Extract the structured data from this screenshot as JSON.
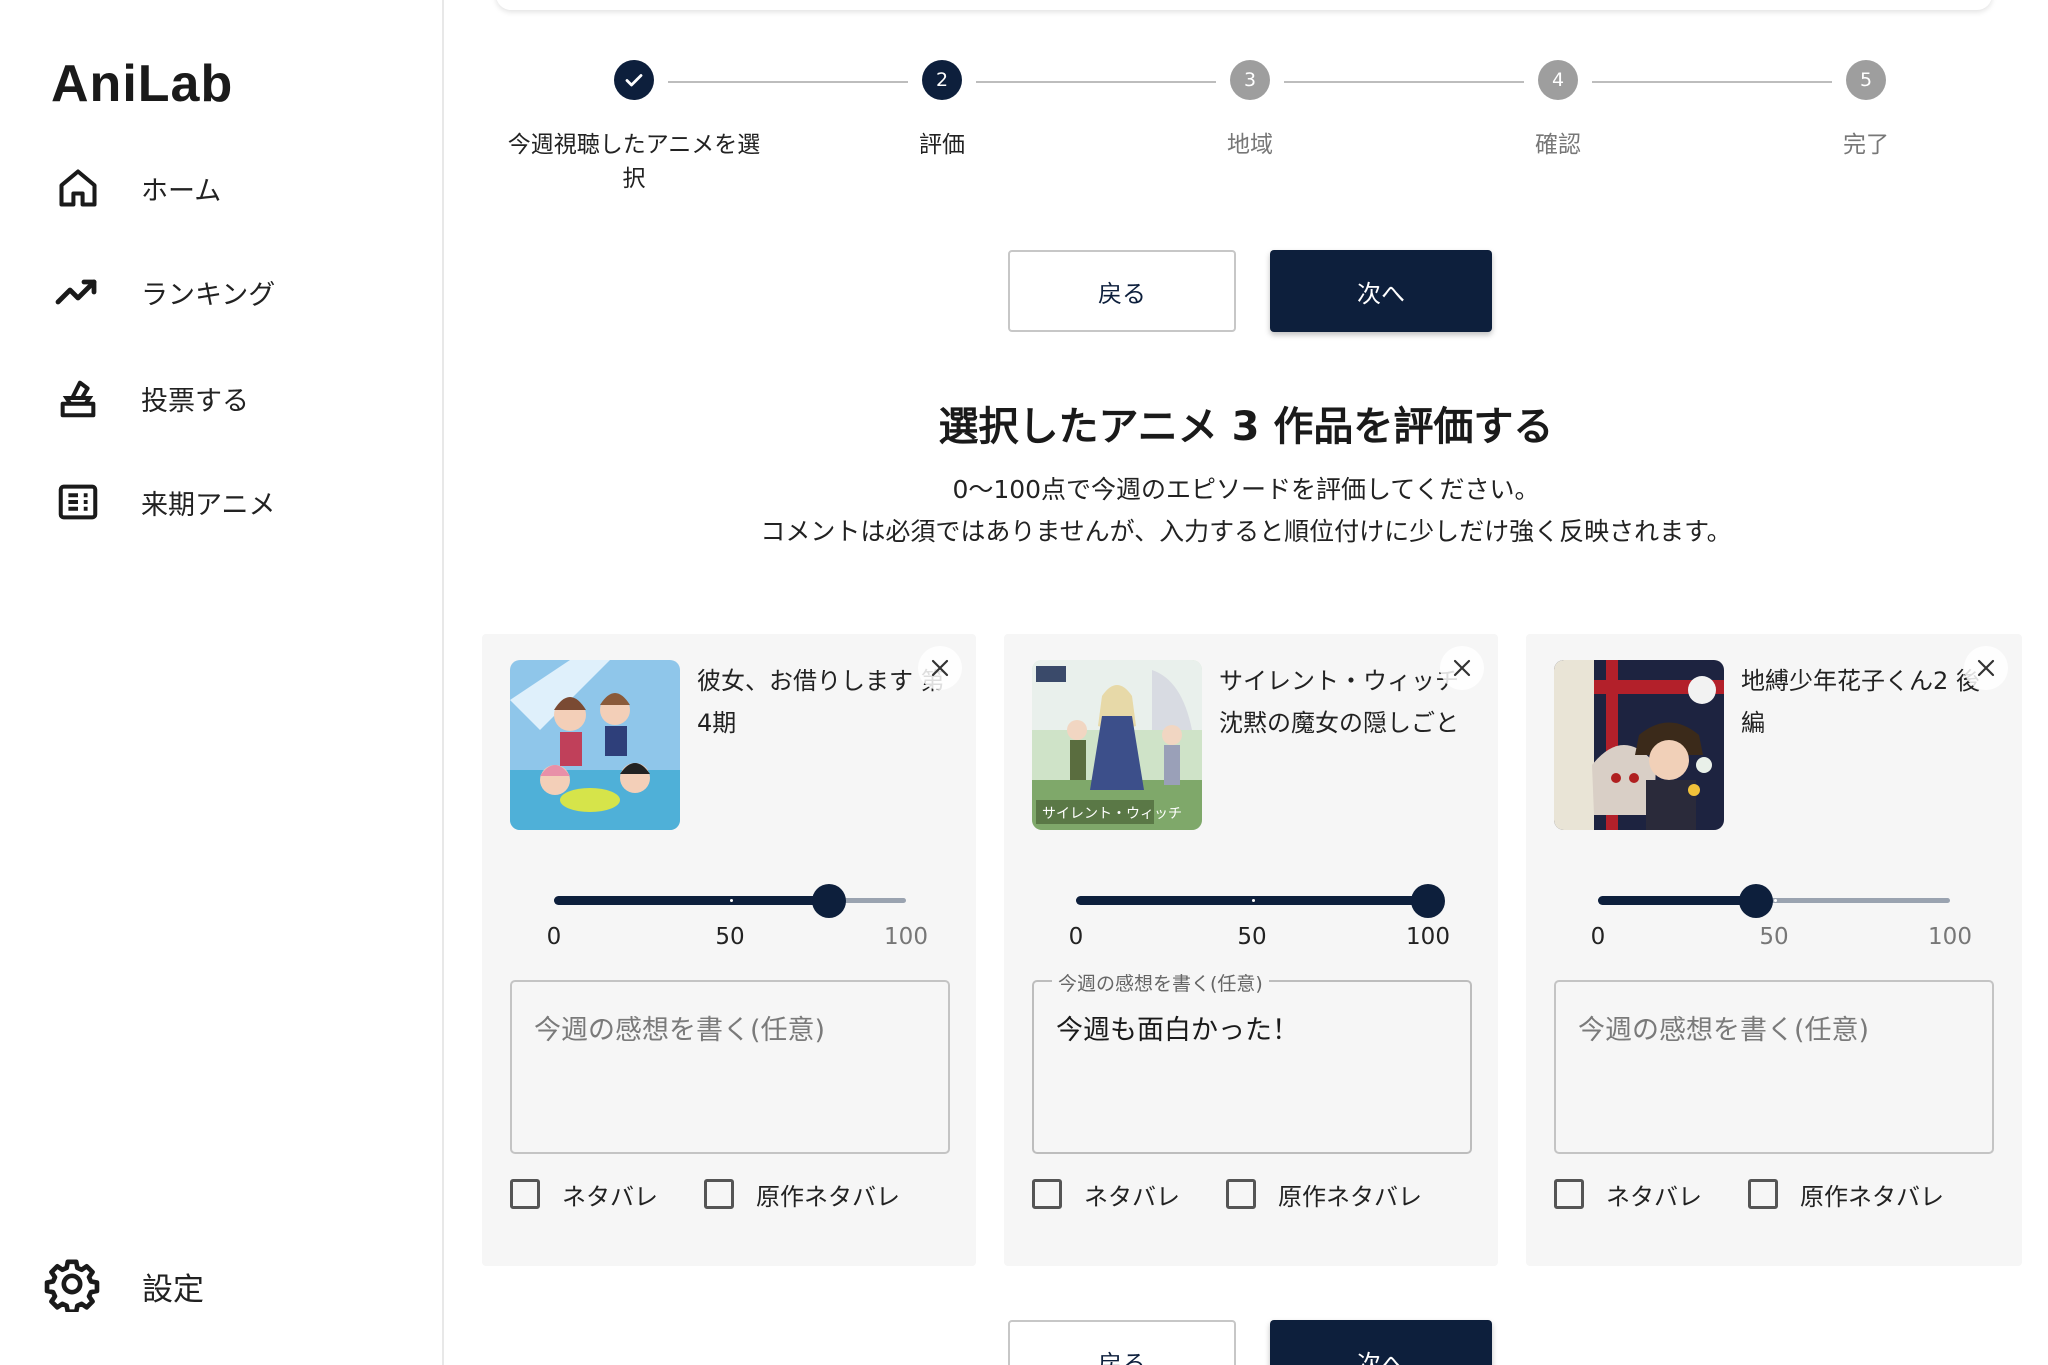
{
  "app": {
    "name": "AniLab"
  },
  "sidebar": {
    "items": [
      {
        "label": "ホーム",
        "icon": "home-icon"
      },
      {
        "label": "ランキング",
        "icon": "trending-up-icon"
      },
      {
        "label": "投票する",
        "icon": "ballot-icon"
      },
      {
        "label": "来期アニメ",
        "icon": "article-icon"
      }
    ],
    "settings": {
      "label": "設定",
      "icon": "gear-icon"
    }
  },
  "stepper": {
    "steps": [
      {
        "number": "",
        "label_line1": "今週視聴したアニメを選",
        "label_line2": "択",
        "state": "completed"
      },
      {
        "number": "2",
        "label_line1": "評価",
        "label_line2": "",
        "state": "active"
      },
      {
        "number": "3",
        "label_line1": "地域",
        "label_line2": "",
        "state": "inactive"
      },
      {
        "number": "4",
        "label_line1": "確認",
        "label_line2": "",
        "state": "inactive"
      },
      {
        "number": "5",
        "label_line1": "完了",
        "label_line2": "",
        "state": "inactive"
      }
    ]
  },
  "actions": {
    "back_label": "戻る",
    "next_label": "次へ"
  },
  "section": {
    "heading": "選択したアニメ 3 作品を評価する",
    "desc_line1": "0〜100点で今週のエピソードを評価してください。",
    "desc_line2": "コメントは必須ではありませんが、入力すると順位付けに少しだけ強く反映されます。"
  },
  "cards": [
    {
      "title": "彼女、お借りします 第4期",
      "score": 78,
      "comment_value": "",
      "comment_placeholder": "今週の感想を書く(任意)",
      "comment_legend": "",
      "spoiler_label": "ネタバレ",
      "source_spoiler_label": "原作ネタバレ",
      "marks": [
        "0",
        "50",
        "100"
      ]
    },
    {
      "title": "サイレント・ウィッチ 沈黙の魔女の隠しごと",
      "score": 100,
      "comment_value": "今週も面白かった！",
      "comment_placeholder": "今週の感想を書く(任意)",
      "comment_legend": "今週の感想を書く(任意)",
      "spoiler_label": "ネタバレ",
      "source_spoiler_label": "原作ネタバレ",
      "marks": [
        "0",
        "50",
        "100"
      ]
    },
    {
      "title": "地縛少年花子くん2 後編",
      "score": 45,
      "comment_value": "",
      "comment_placeholder": "今週の感想を書く(任意)",
      "comment_legend": "",
      "spoiler_label": "ネタバレ",
      "source_spoiler_label": "原作ネタバレ",
      "marks": [
        "0",
        "50",
        "100"
      ]
    }
  ],
  "colors": {
    "primary": "#0d1f3c",
    "inactive_step": "#9e9e9e",
    "card_bg": "#f6f6f6"
  }
}
